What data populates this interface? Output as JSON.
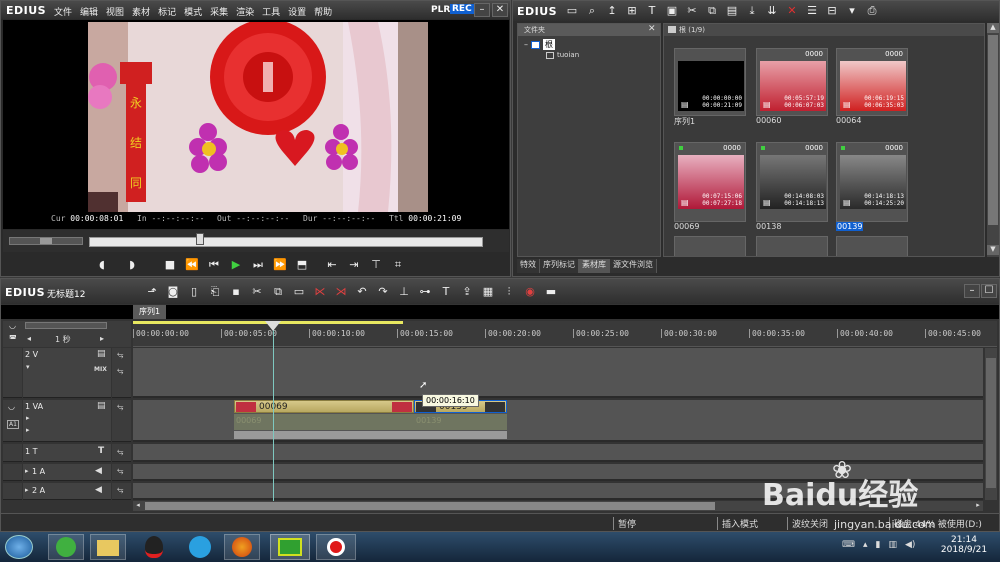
{
  "app": {
    "logo": "EDIUS",
    "menu": [
      "文件",
      "编辑",
      "视图",
      "素材",
      "标记",
      "模式",
      "采集",
      "渲染",
      "工具",
      "设置",
      "帮助"
    ],
    "plr": "PLR",
    "rec": "REC",
    "min": "–",
    "max": "☐",
    "close": "✕"
  },
  "player": {
    "cur_label": "Cur",
    "cur_value": "00:00:08:01",
    "in_label": "In",
    "in_value": "--:--:--:--",
    "out_label": "Out",
    "out_value": "--:--:--:--",
    "dur_label": "Dur",
    "dur_value": "--:--:--:--",
    "ttl_label": "Ttl",
    "ttl_value": "00:00:21:09",
    "scrub_position": 0.28
  },
  "bin": {
    "logo": "EDIUS",
    "folder_header": "文件夹",
    "tree_root": "根",
    "tree_child": "tuoian",
    "path_label": "根 (1/9)",
    "items": [
      {
        "name": "序列1",
        "count": "",
        "tc1": "00:00:00:00",
        "tc2": "00:00:21:09",
        "colors": [
          "#000000",
          "#000000"
        ]
      },
      {
        "name": "00060",
        "count": "0000",
        "tc1": "00:05:57:19",
        "tc2": "00:06:07:03",
        "colors": [
          "#e8a0a8",
          "#c02030"
        ]
      },
      {
        "name": "00064",
        "count": "0000",
        "tc1": "00:06:19:15",
        "tc2": "00:06:35:03",
        "colors": [
          "#f0c8c8",
          "#d02020"
        ]
      },
      {
        "name": "00069",
        "count": "0000",
        "tc1": "00:07:15:06",
        "tc2": "00:07:27:18",
        "colors": [
          "#e8b0c0",
          "#b01838"
        ]
      },
      {
        "name": "00138",
        "count": "0000",
        "tc1": "00:14:08:03",
        "tc2": "00:14:18:13",
        "colors": [
          "#777777",
          "#222222"
        ]
      },
      {
        "name": "00139",
        "count": "0000",
        "tc1": "00:14:18:13",
        "tc2": "00:14:25:20",
        "colors": [
          "#888888",
          "#2a2a2a"
        ]
      }
    ],
    "tabs": [
      "特效",
      "序列标记",
      "素材库",
      "源文件浏览"
    ]
  },
  "timeline": {
    "logo": "EDIUS",
    "project_name": "无标题12",
    "sequence_tab": "序列1",
    "zoom_label": "1 秒",
    "ruler": [
      "00:00:00:00",
      "00:00:05:00",
      "00:00:10:00",
      "00:00:15:00",
      "00:00:20:00",
      "00:00:25:00",
      "00:00:30:00",
      "00:00:35:00",
      "00:00:40:00",
      "00:00:45:00"
    ],
    "tracks": [
      {
        "label": "2 V",
        "mix": "MIX"
      },
      {
        "label": "1 VA"
      },
      {
        "label": "1 T"
      },
      {
        "label": "1 A"
      },
      {
        "label": "2 A"
      }
    ],
    "clips": [
      {
        "name": "00069",
        "audio_name": "00069"
      },
      {
        "name": "00139",
        "audio_name": "00139"
      }
    ],
    "tooltip": "00:00:16:10"
  },
  "status": {
    "pause": "暂停",
    "insert_mode": "插入模式",
    "ripple": "波纹关闭",
    "disk": "磁盘:44% 被使用(D:)"
  },
  "taskbar": {
    "time": "21:14",
    "date": "2018/9/21"
  },
  "watermark": {
    "line1": "Baidu经验",
    "line2": "jingyan.baidu.com"
  },
  "colors": {
    "accent_blue": "#1060d0",
    "playhead": "#7ec8c0",
    "play_green": "#40d040"
  }
}
